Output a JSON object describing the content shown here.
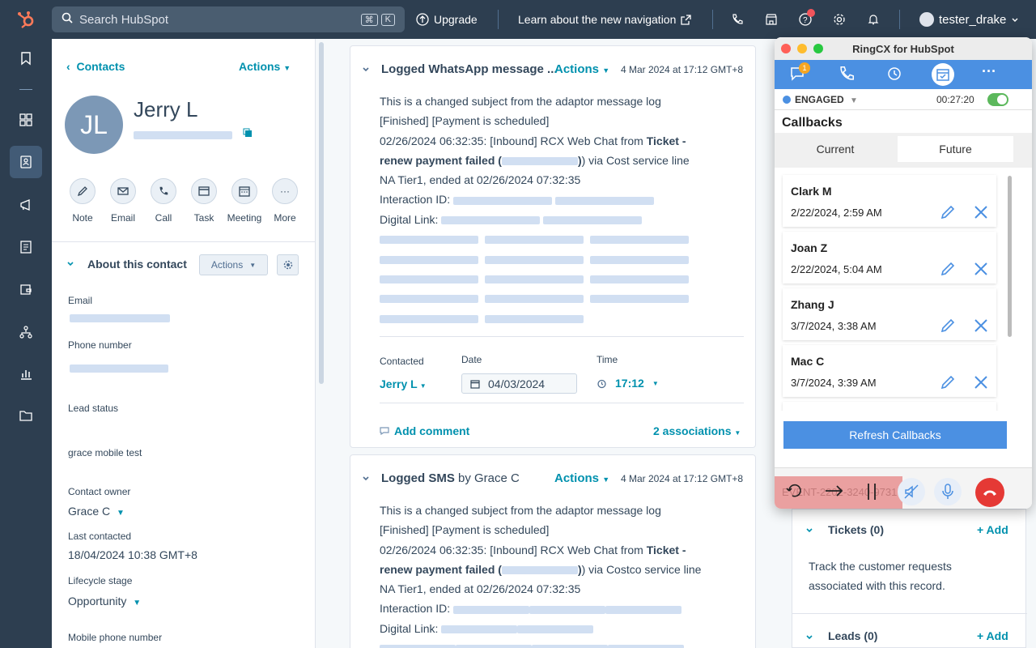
{
  "topbar": {
    "search_placeholder": "Search HubSpot",
    "kbd1": "⌘",
    "kbd2": "K",
    "upgrade": "Upgrade",
    "learn": "Learn about the new navigation",
    "user": "tester_drake"
  },
  "contact": {
    "back": "Contacts",
    "actions": "Actions",
    "name": "Jerry L",
    "initials": "JL"
  },
  "quick_actions": [
    "Note",
    "Email",
    "Call",
    "Task",
    "Meeting",
    "More"
  ],
  "about": {
    "title": "About this contact",
    "actions": "Actions"
  },
  "props": {
    "email_label": "Email",
    "phone_label": "Phone number",
    "lead_status_label": "Lead status",
    "lead_status_value": "grace mobile test",
    "owner_label": "Contact owner",
    "owner_value": "Grace C",
    "last_contacted_label": "Last contacted",
    "last_contacted_value": "18/04/2024 10:38 GMT+8",
    "lifecycle_label": "Lifecycle stage",
    "lifecycle_value": "Opportunity",
    "mobile_label": "Mobile phone number"
  },
  "card1": {
    "title": "Logged WhatsApp message ...",
    "actions": "Actions",
    "date": "4 Mar 2024 at 17:12 GMT+8",
    "line1": "This is a changed subject from the adaptor message log",
    "line2": "[Finished] [Payment is scheduled]",
    "line3a": "02/26/2024 06:32:35: [Inbound] RCX Web Chat from ",
    "line3b": "Ticket -",
    "line4a": "renew payment failed (",
    "line4b": ") via Cost service line",
    "line5": "NA Tier1, ended at 02/26/2024 07:32:35",
    "interaction": "Interaction ID:",
    "digital": "Digital Link:",
    "contacted_label": "Contacted",
    "contacted_value": "Jerry L",
    "date_label": "Date",
    "date_value": "04/03/2024",
    "time_label": "Time",
    "time_value": "17:12",
    "add_comment": "Add comment",
    "associations": "2 associations"
  },
  "card2": {
    "title_a": "Logged SMS",
    "title_b": " by Grace C",
    "actions": "Actions",
    "date": "4 Mar 2024 at 17:12 GMT+8",
    "line1": "This is a changed subject from the adaptor message log",
    "line2": "[Finished] [Payment is scheduled]",
    "line3a": "02/26/2024 06:32:35: [Inbound] RCX Web Chat from ",
    "line3b": "Ticket -",
    "line4a": "renew payment failed (",
    "line4b": ") via Costco service line",
    "line5": "NA Tier1, ended at 02/26/2024 07:32:35",
    "interaction": "Interaction ID:",
    "digital": "Digital Link:"
  },
  "ringcx": {
    "title": "RingCX for HubSpot",
    "badge": "1",
    "status": "ENGAGED",
    "timer": "00:27:20",
    "section": "Callbacks",
    "tab_current": "Current",
    "tab_future": "Future",
    "refresh": "Refresh Callbacks",
    "call_id": "EVENT-2202-3240-9731",
    "callbacks": [
      {
        "name": "Clark M",
        "time": "2/22/2024, 2:59 AM"
      },
      {
        "name": "Joan Z",
        "time": "2/22/2024, 5:04 AM"
      },
      {
        "name": "Zhang J",
        "time": "3/7/2024, 3:38 AM"
      },
      {
        "name": "Mac C",
        "time": "3/7/2024, 3:39 AM"
      }
    ]
  },
  "right": {
    "tickets": "Tickets (0)",
    "tickets_add": "+ Add",
    "tickets_desc": "Track the customer requests associated with this record.",
    "leads": "Leads (0)",
    "leads_add": "+ Add"
  },
  "colors": {
    "hubspot_orange": "#ff7a59",
    "link": "#0091ae",
    "ringcx_blue": "#4b90e2",
    "hangup_red": "#e53935",
    "engaged_toggle": "#5cb85c"
  }
}
